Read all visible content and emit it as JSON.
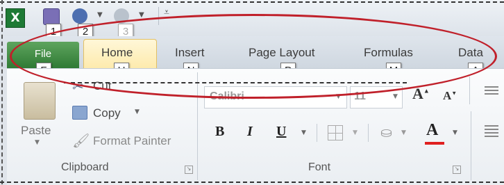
{
  "quick_access": {
    "app_logo": "X",
    "keytips": [
      "1",
      "2",
      "3"
    ]
  },
  "tabs": [
    {
      "label": "File",
      "keytip": "F"
    },
    {
      "label": "Home",
      "keytip": "H"
    },
    {
      "label": "Insert",
      "keytip": "N"
    },
    {
      "label": "Page Layout",
      "keytip": "P"
    },
    {
      "label": "Formulas",
      "keytip": "M"
    },
    {
      "label": "Data",
      "keytip": "A"
    }
  ],
  "clipboard": {
    "paste": "Paste",
    "cut": "Cut",
    "copy": "Copy",
    "format_painter": "Format Painter",
    "group_label": "Clipboard"
  },
  "font": {
    "name": "Calibri",
    "size": "11",
    "bold": "B",
    "italic": "I",
    "underline": "U",
    "font_color_glyph": "A",
    "group_label": "Font"
  },
  "colors": {
    "annotation_red": "#c0202a",
    "file_tab_green": "#2f7a34",
    "font_color_red": "#e02020"
  }
}
